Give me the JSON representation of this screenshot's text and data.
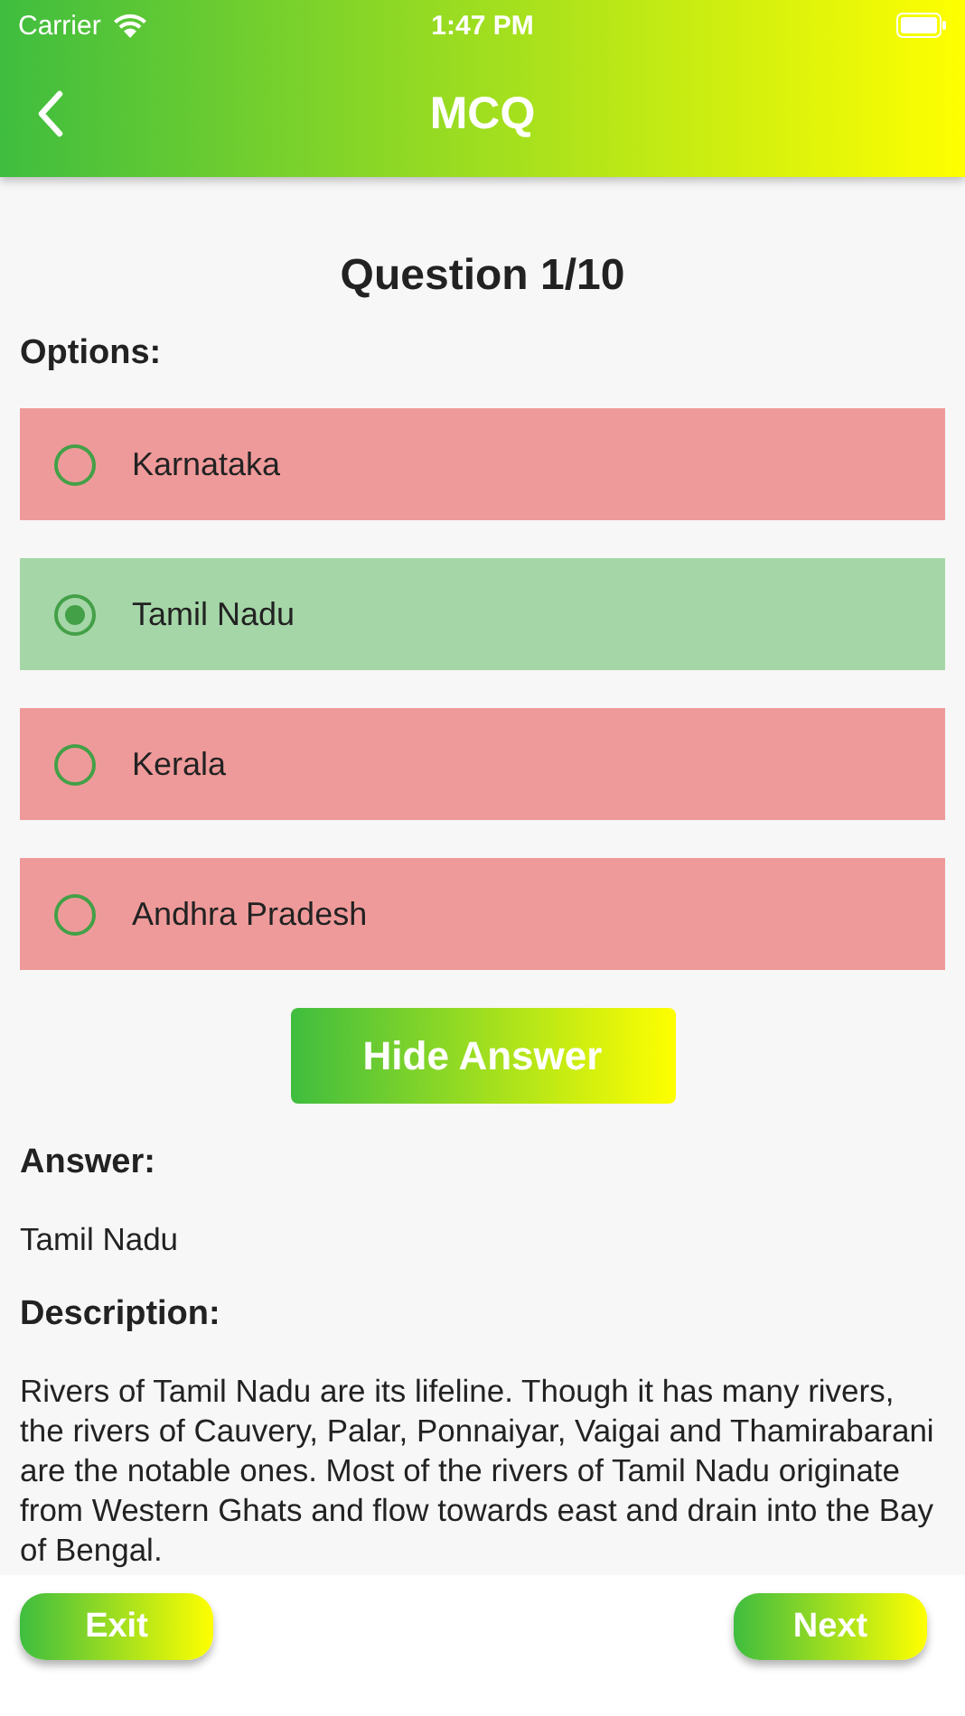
{
  "status_bar": {
    "carrier": "Carrier",
    "time": "1:47 PM"
  },
  "header": {
    "title": "MCQ"
  },
  "question": {
    "title": "Question 1/10",
    "options_label": "Options:",
    "options": [
      {
        "label": "Karnataka",
        "correct": false,
        "selected": false
      },
      {
        "label": "Tamil Nadu",
        "correct": true,
        "selected": true
      },
      {
        "label": "Kerala",
        "correct": false,
        "selected": false
      },
      {
        "label": "Andhra Pradesh",
        "correct": false,
        "selected": false
      }
    ]
  },
  "toggle_button": "Hide Answer",
  "answer": {
    "label": "Answer:",
    "value": "Tamil Nadu"
  },
  "description": {
    "label": "Description:",
    "text": "Rivers of Tamil Nadu are its lifeline. Though it has many rivers, the rivers of Cauvery, Palar, Ponnaiyar, Vaigai and Thamirabarani are the notable ones. Most of the rivers of Tamil Nadu originate from Western Ghats and flow towards east and drain into the Bay of Bengal."
  },
  "footer": {
    "buttons": [
      "Exit",
      "Next"
    ]
  }
}
